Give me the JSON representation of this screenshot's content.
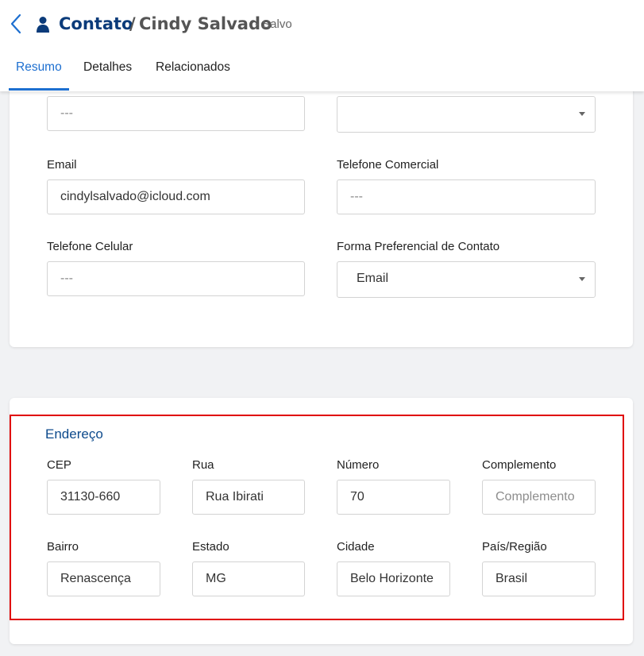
{
  "header": {
    "entity": "Contato",
    "separator": "/",
    "record_name": "Cindy Salvado",
    "status": "- Salvo"
  },
  "tabs": [
    {
      "label": "Resumo",
      "active": true
    },
    {
      "label": "Detalhes",
      "active": false
    },
    {
      "label": "Relacionados",
      "active": false
    }
  ],
  "contact": {
    "top_left_value": "---",
    "top_right_value": "",
    "email_label": "Email",
    "email_value": "cindylsalvado@icloud.com",
    "phone_business_label": "Telefone Comercial",
    "phone_business_value": "---",
    "mobile_label": "Telefone Celular",
    "mobile_value": "---",
    "preferred_label": "Forma Preferencial de Contato",
    "preferred_value": "Email"
  },
  "address": {
    "title": "Endereço",
    "cep_label": "CEP",
    "cep_value": "31130-660",
    "street_label": "Rua",
    "street_value": "Rua Ibirati",
    "number_label": "Número",
    "number_value": "70",
    "complement_label": "Complemento",
    "complement_placeholder": "Complemento",
    "district_label": "Bairro",
    "district_value": "Renascença",
    "state_label": "Estado",
    "state_value": "MG",
    "city_label": "Cidade",
    "city_value": "Belo Horizonte",
    "country_label": "País/Região",
    "country_value": "Brasil"
  },
  "colors": {
    "accent": "#1d6fd0",
    "title": "#0b3b7a",
    "highlight": "#e00000"
  },
  "icons": {
    "back": "chevron-left-icon",
    "entity": "person-icon",
    "dropdown": "caret-down-icon"
  }
}
